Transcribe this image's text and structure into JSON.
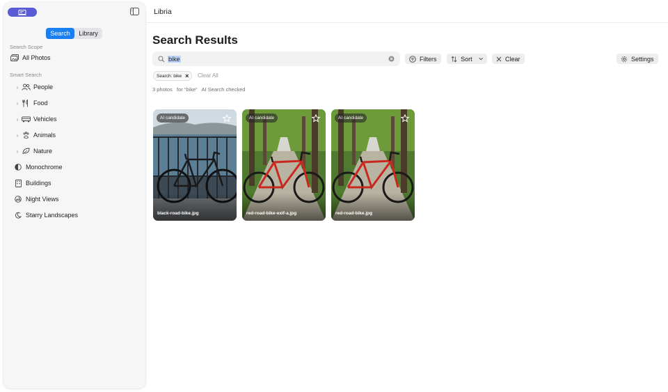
{
  "app": {
    "window_title": "Libria"
  },
  "sidebar": {
    "segments": [
      {
        "label": "Search",
        "active": true
      },
      {
        "label": "Library",
        "active": false
      }
    ],
    "scope_label": "Search Scope",
    "scope_item": {
      "label": "All Photos",
      "icon": "photos-icon"
    },
    "smart_label": "Smart Search",
    "items": [
      {
        "label": "People",
        "icon": "people-icon",
        "expandable": true
      },
      {
        "label": "Food",
        "icon": "fork-knife-icon",
        "expandable": true
      },
      {
        "label": "Vehicles",
        "icon": "car-icon",
        "expandable": true
      },
      {
        "label": "Animals",
        "icon": "pawprint-icon",
        "expandable": true
      },
      {
        "label": "Nature",
        "icon": "leaf-icon",
        "expandable": true
      },
      {
        "label": "Monochrome",
        "icon": "half-circle-icon",
        "expandable": false
      },
      {
        "label": "Buildings",
        "icon": "building-icon",
        "expandable": false
      },
      {
        "label": "Night Views",
        "icon": "moon-city-icon",
        "expandable": false
      },
      {
        "label": "Starry Landscapes",
        "icon": "moon-stars-icon",
        "expandable": false
      }
    ]
  },
  "main": {
    "title": "Search Results",
    "search": {
      "value": "bike",
      "placeholder": ""
    },
    "toolbar": {
      "filters_label": "Filters",
      "sort_label": "Sort",
      "clear_label": "Clear",
      "settings_label": "Settings"
    },
    "chip_label": "Search: bike",
    "clear_all_label": "Clear All",
    "result_count": "3 photos",
    "result_query": "for “bike”",
    "result_status": "AI Search checked",
    "photos": [
      {
        "badge": "AI candidate",
        "filename": "black-road-bike.jpg",
        "frame_color": "#1a1a1a"
      },
      {
        "badge": "AI candidate",
        "filename": "red-road-bike-exif-a.jpg",
        "frame_color": "#c8281e"
      },
      {
        "badge": "AI candidate",
        "filename": "red-road-bike.jpg",
        "frame_color": "#c8281e"
      }
    ]
  },
  "colors": {
    "accent": "#1a7ff0",
    "app_pill": "#5b5bd6",
    "selection": "#bcd6fb"
  }
}
